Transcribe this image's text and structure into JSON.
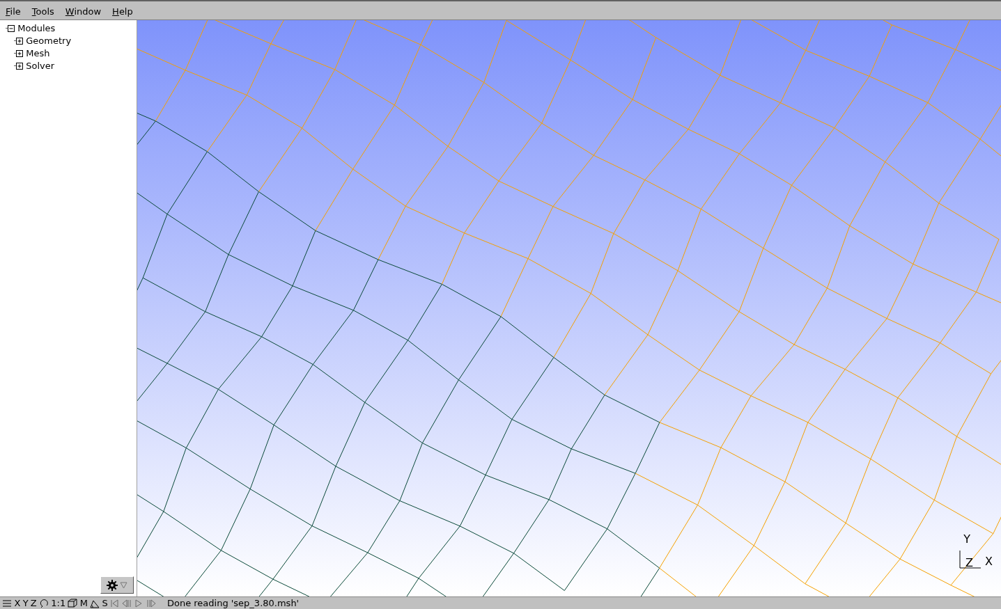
{
  "menu": [
    {
      "label": "File"
    },
    {
      "label": "Tools"
    },
    {
      "label": "Window"
    },
    {
      "label": "Help"
    }
  ],
  "tree": [
    {
      "label": "Modules",
      "expanded": true,
      "children": [
        {
          "label": "Geometry",
          "expanded": false
        },
        {
          "label": "Mesh",
          "expanded": false
        },
        {
          "label": "Solver",
          "expanded": false
        }
      ]
    }
  ],
  "axes": {
    "y": "Y",
    "z": "Z",
    "x": "X"
  },
  "status_bar": {
    "labels": [
      "X",
      "Y",
      "Z",
      "1:1",
      "M",
      "S"
    ],
    "playback_disabled": true,
    "message": "Done reading 'sep_3.80.msh'"
  }
}
